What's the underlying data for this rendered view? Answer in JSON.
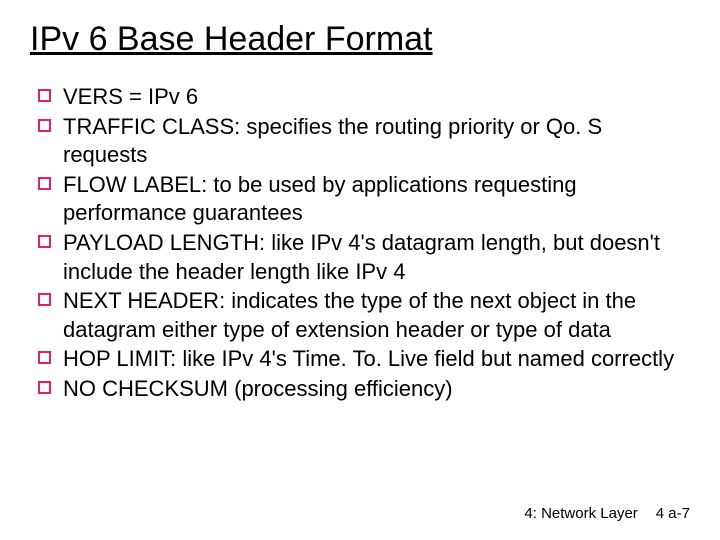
{
  "title": "IPv 6 Base Header Format",
  "bullets": [
    "VERS = IPv 6",
    "TRAFFIC CLASS: specifies the routing priority or Qo. S requests",
    "FLOW LABEL: to be used by applications requesting performance guarantees",
    "PAYLOAD LENGTH: like IPv 4's datagram length, but doesn't include the header length like IPv 4",
    "NEXT HEADER:  indicates the type of the next object in the datagram either type of extension header or type of data",
    "HOP LIMIT: like IPv 4's Time. To. Live field but named correctly",
    "NO CHECKSUM (processing efficiency)"
  ],
  "footer": {
    "section": "4: Network Layer",
    "page": "4 a-7"
  }
}
